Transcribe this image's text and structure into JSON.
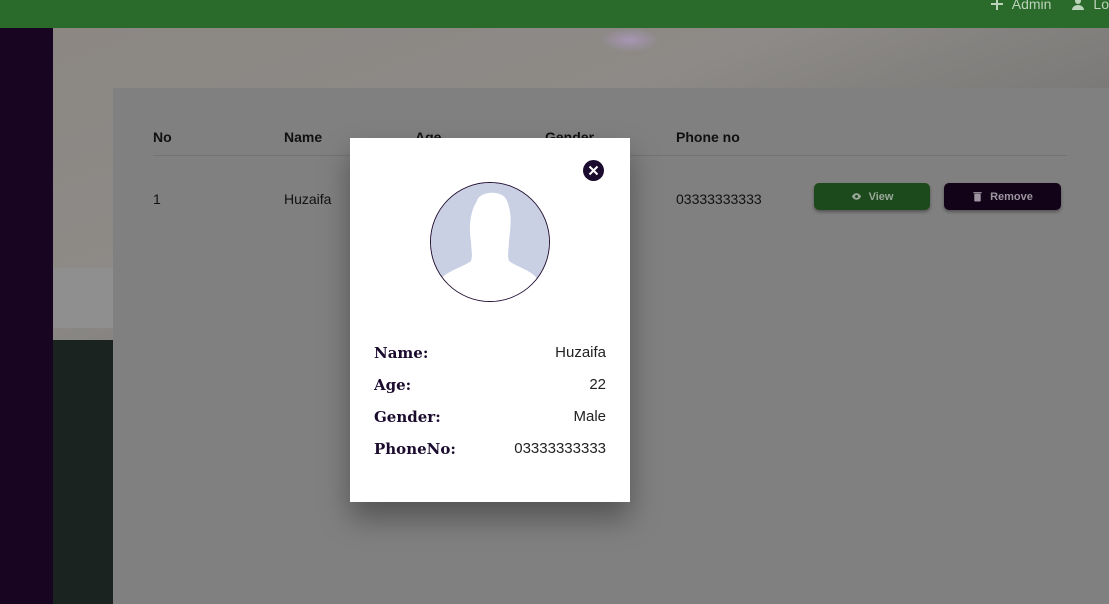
{
  "topnav": {
    "items": [
      {
        "label": "Admin",
        "icon": "plus-icon"
      },
      {
        "label": "Lo",
        "icon": "user-icon"
      }
    ]
  },
  "table": {
    "headers": [
      "No",
      "Name",
      "Age",
      "Gender",
      "Phone no"
    ],
    "rows": [
      {
        "no": "1",
        "name": "Huzaifa",
        "phone": "03333333333"
      }
    ],
    "view_label": "View",
    "remove_label": "Remove"
  },
  "modal": {
    "fields": [
      {
        "label": "Name:",
        "value": "Huzaifa"
      },
      {
        "label": "Age:",
        "value": "22"
      },
      {
        "label": "Gender:",
        "value": "Male"
      },
      {
        "label": "PhoneNo:",
        "value": "03333333333"
      }
    ]
  },
  "colors": {
    "topbar": "#2a6a2a",
    "sidebar": "#180522",
    "view_button": "#1d4a1d",
    "remove_button": "#120318",
    "label_color": "#1b0b2e"
  }
}
